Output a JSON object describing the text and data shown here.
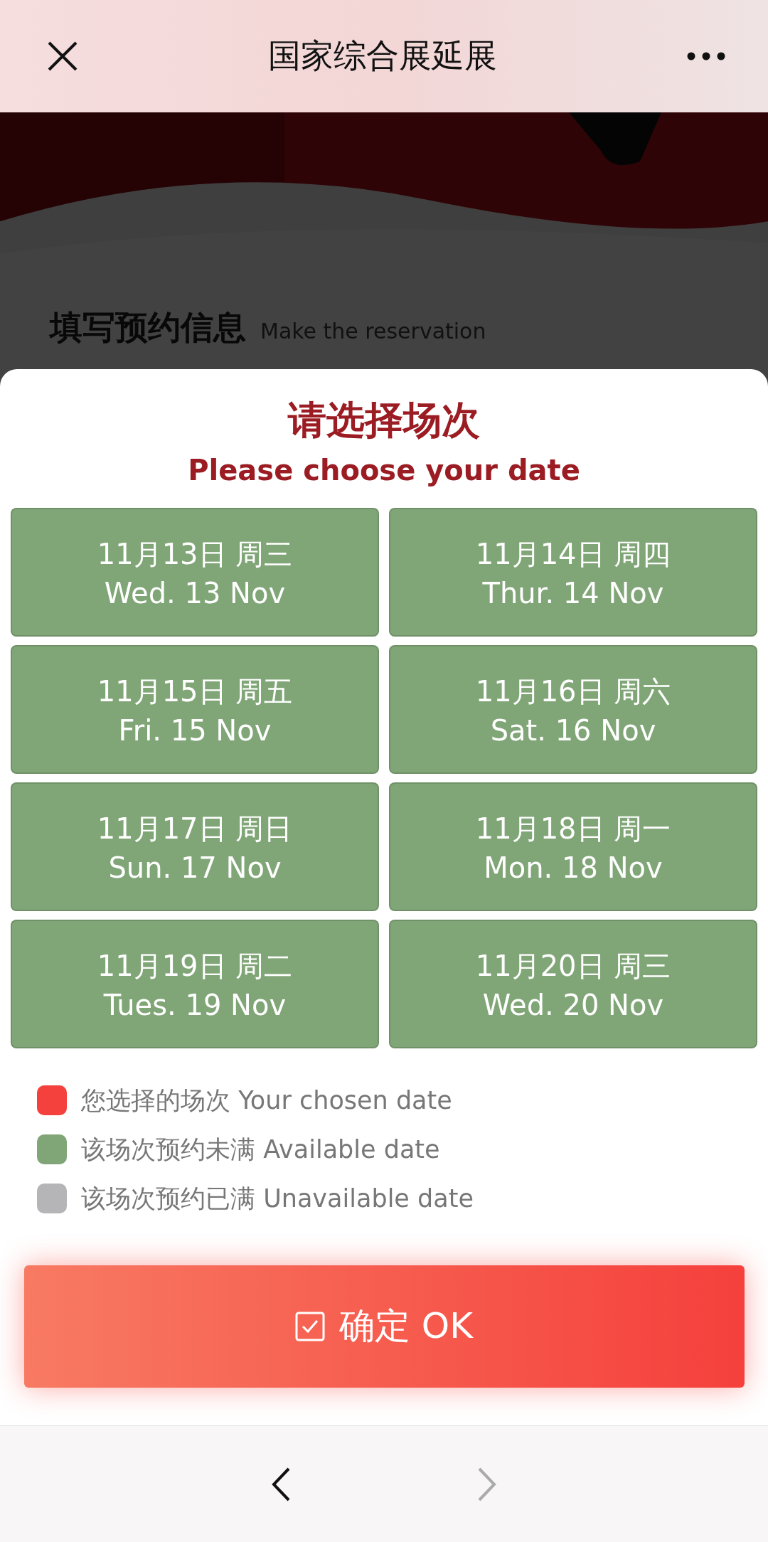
{
  "header": {
    "title": "国家综合展延展"
  },
  "background_page": {
    "heading": "填写预约信息",
    "heading_en": "Make the reservation"
  },
  "dialog": {
    "title": "请选择场次",
    "subtitle": "Please choose your date",
    "dates": [
      {
        "zh": "11月13日 周三",
        "en": "Wed. 13 Nov",
        "kind": "available"
      },
      {
        "zh": "11月14日 周四",
        "en": "Thur. 14 Nov",
        "kind": "available"
      },
      {
        "zh": "11月15日 周五",
        "en": "Fri. 15 Nov",
        "kind": "available"
      },
      {
        "zh": "11月16日 周六",
        "en": "Sat. 16 Nov",
        "kind": "available"
      },
      {
        "zh": "11月17日 周日",
        "en": "Sun. 17 Nov",
        "kind": "available"
      },
      {
        "zh": "11月18日 周一",
        "en": "Mon. 18 Nov",
        "kind": "available"
      },
      {
        "zh": "11月19日 周二",
        "en": "Tues. 19 Nov",
        "kind": "available"
      },
      {
        "zh": "11月20日 周三",
        "en": "Wed. 20 Nov",
        "kind": "available"
      }
    ],
    "legend": [
      {
        "label": "您选择的场次 Your chosen date",
        "color": "#f5413d"
      },
      {
        "label": "该场次预约未满 Available date",
        "color": "#80a677"
      },
      {
        "label": "该场次预约已满 Unavailable date",
        "color": "#b5b5b7"
      }
    ],
    "confirm_button": "确定 OK"
  },
  "nav": {
    "back_disabled": false,
    "forward_disabled": true
  }
}
